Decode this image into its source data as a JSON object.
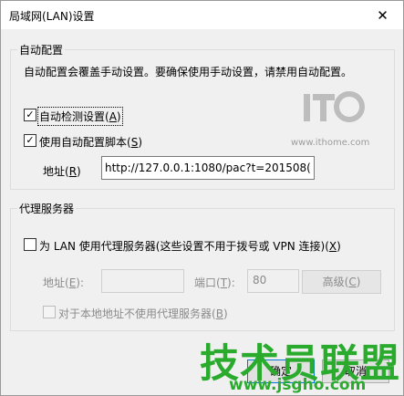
{
  "window": {
    "title": "局域网(LAN)设置",
    "close_glyph": "✕"
  },
  "auto_config": {
    "group_label": "自动配置",
    "description": "自动配置会覆盖手动设置。要确保使用手动设置，请禁用自动配置。",
    "auto_detect": {
      "checked": true,
      "label": "自动检测设置",
      "accel": "A"
    },
    "use_script": {
      "checked": true,
      "label": "使用自动配置脚本",
      "accel": "S"
    },
    "address_label": "地址",
    "address_accel": "R",
    "address_value": "http://127.0.0.1:1080/pac?t=201508("
  },
  "proxy": {
    "group_label": "代理服务器",
    "use_proxy": {
      "checked": false,
      "label": "为 LAN 使用代理服务器(这些设置不用于拨号或 VPN 连接)",
      "accel": "X"
    },
    "address_label": "地址",
    "address_accel": "E",
    "address_value": "",
    "port_label": "端口",
    "port_accel": "T",
    "port_value": "80",
    "advanced_label": "高级",
    "advanced_accel": "C",
    "bypass_local": {
      "checked": false,
      "label": "对于本地地址不使用代理服务器",
      "accel": "B"
    }
  },
  "footer": {
    "ok_label": "确定",
    "cancel_label": "取消"
  },
  "watermarks": {
    "ithome_url": "www.ithome.com",
    "jsgho_big": "技术员联盟",
    "jsgho_url": "www.jsgho.com"
  },
  "icons": {
    "close": "close-icon",
    "checkbox_checked": "checkmark-icon",
    "ithome": "ithome-logo-icon"
  }
}
